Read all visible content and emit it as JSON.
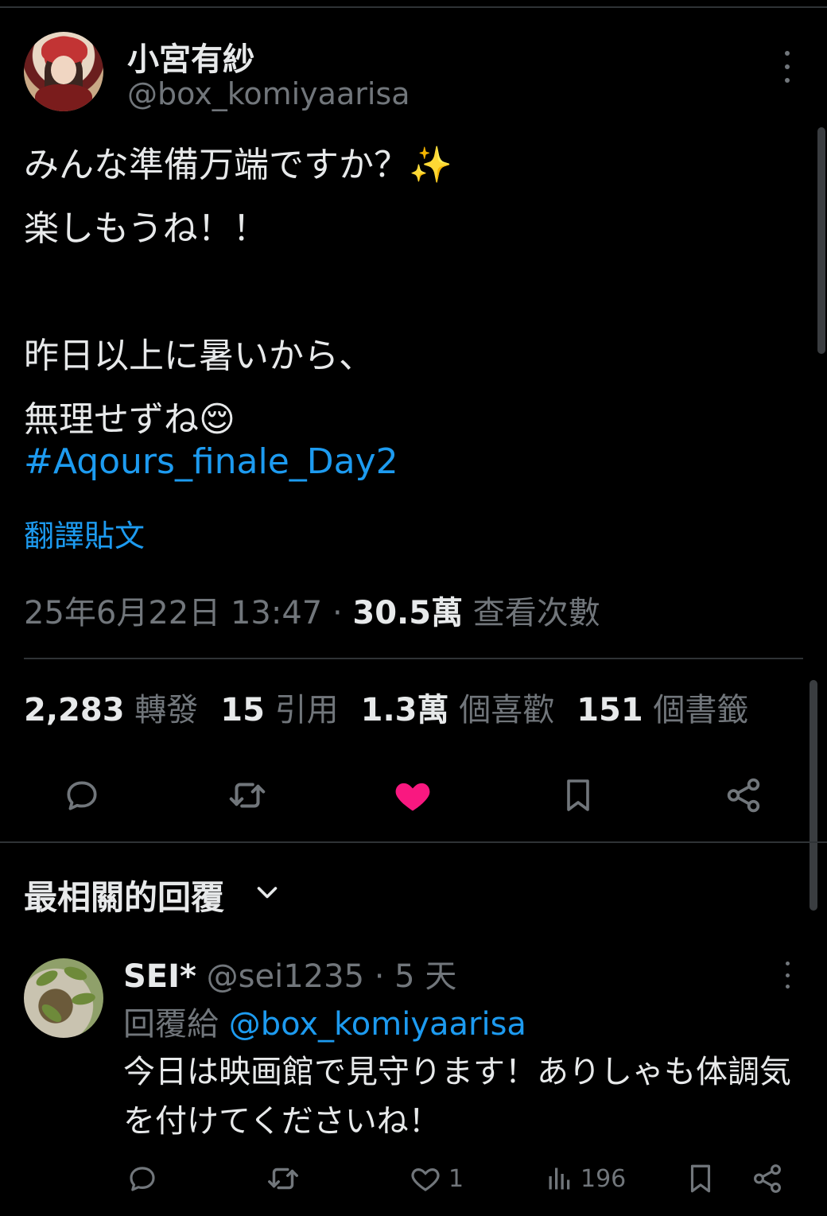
{
  "tweet": {
    "display_name": "小宮有紗",
    "handle": "@box_komiyaarisa",
    "text": "みんな準備万端ですか？✨\n楽しもうね！！\n\n昨日以上に暑いから、\n無理せずね😌",
    "hashtag": "#Aqours_finale_Day2",
    "translate_label": "翻譯貼文",
    "timestamp": "25年6月22日 13:47",
    "separator": " · ",
    "views_count": "30.5萬",
    "views_label": " 查看次數"
  },
  "stats": {
    "retweets_count": "2,283",
    "retweets_label": " 轉發",
    "quotes_count": "15",
    "quotes_label": " 引用",
    "likes_count": "1.3萬",
    "likes_label": " 個喜歡",
    "bookmarks_count": "151",
    "bookmarks_label": " 個書籤"
  },
  "colors": {
    "background": "#000000",
    "text": "#e7e9ea",
    "muted": "#71767b",
    "link": "#1d9bf0",
    "like": "#f91880",
    "divider": "#2f3336"
  },
  "replies_section": {
    "title": "最相關的回覆"
  },
  "reply": {
    "display_name": "SEI*",
    "handle": "@sei1235",
    "separator": " · ",
    "time": "5 天",
    "reply_to_label": "回覆給 ",
    "reply_to_mention": "@box_komiyaarisa",
    "text": "今日は映画館で見守ります！ありしゃも体調気を付けてくださいね！",
    "likes": "1",
    "views": "196"
  },
  "icons": [
    "more-icon",
    "reply-icon",
    "retweet-icon",
    "like-icon",
    "bookmark-icon",
    "share-icon",
    "chevron-down-icon",
    "views-icon"
  ]
}
